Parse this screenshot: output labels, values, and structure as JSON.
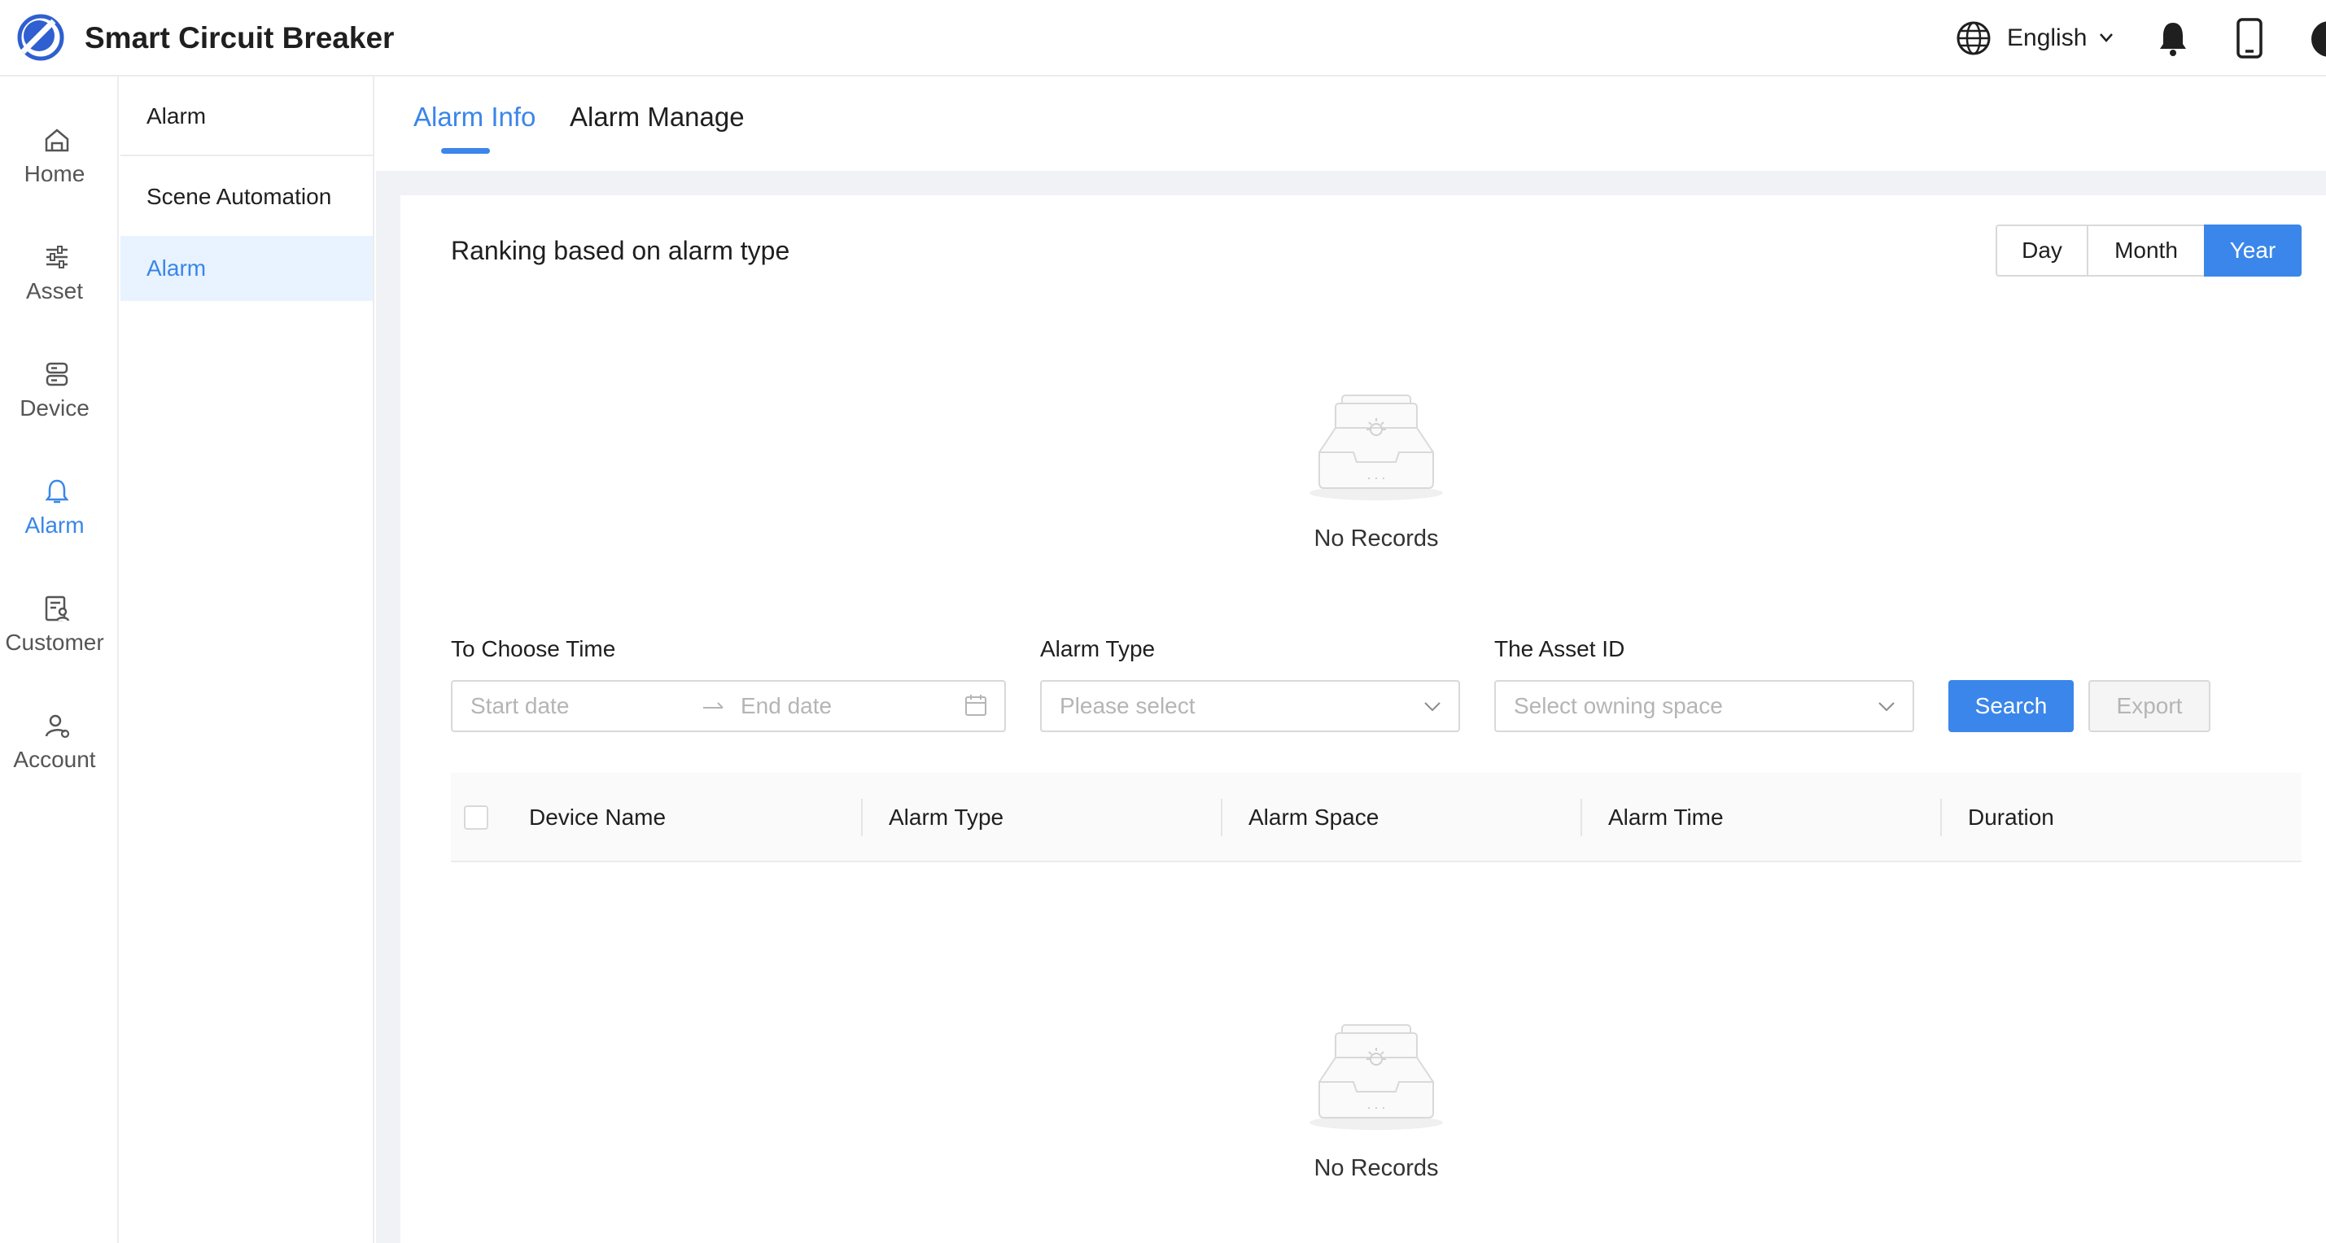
{
  "header": {
    "app_title": "Smart Circuit Breaker",
    "language": "English",
    "icons": [
      "logo-icon",
      "globe-icon",
      "chevron-down-icon",
      "bell-icon",
      "phone-icon",
      "avatar-icon"
    ]
  },
  "rail": {
    "items": [
      {
        "label": "Home",
        "icon": "home-icon"
      },
      {
        "label": "Asset",
        "icon": "sliders-icon"
      },
      {
        "label": "Device",
        "icon": "server-icon"
      },
      {
        "label": "Alarm",
        "icon": "bell-icon",
        "active": true
      },
      {
        "label": "Customer",
        "icon": "customer-icon"
      },
      {
        "label": "Account",
        "icon": "user-icon"
      }
    ]
  },
  "submenu": {
    "header": "Alarm",
    "items": [
      {
        "label": "Scene Automation"
      },
      {
        "label": "Alarm",
        "active": true
      }
    ],
    "collapse_glyph": "«"
  },
  "tabs": {
    "items": [
      {
        "label": "Alarm Info",
        "active": true
      },
      {
        "label": "Alarm Manage"
      }
    ]
  },
  "ranking": {
    "title": "Ranking based on alarm type",
    "periods": [
      "Day",
      "Month",
      "Year"
    ],
    "selected_period": "Year",
    "empty_text": "No Records"
  },
  "filters": {
    "time_label": "To Choose Time",
    "start_placeholder": "Start date",
    "end_placeholder": "End date",
    "alarm_type_label": "Alarm Type",
    "alarm_type_placeholder": "Please select",
    "asset_label": "The Asset ID",
    "asset_placeholder": "Select owning space",
    "search_label": "Search",
    "export_label": "Export"
  },
  "table": {
    "columns": [
      "Device Name",
      "Alarm Type",
      "Alarm Space",
      "Alarm Time",
      "Duration"
    ],
    "rows": [],
    "empty_text": "No Records"
  },
  "colors": {
    "accent": "#3a86ea",
    "active_bg": "#e8f3ff",
    "page_bg": "#f0f2f5"
  }
}
